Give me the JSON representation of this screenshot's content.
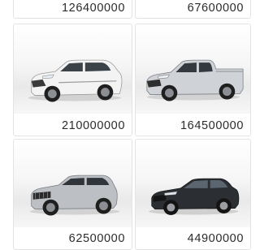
{
  "listings": [
    {
      "price": "126400000",
      "image": "car-image"
    },
    {
      "price": "67600000",
      "image": "car-image"
    },
    {
      "price": "210000000",
      "image": "white-suv-image",
      "color": "#f4f4f4"
    },
    {
      "price": "164500000",
      "image": "silver-pickup-truck-image",
      "color": "#c9cdd1"
    },
    {
      "price": "62500000",
      "image": "silver-compact-suv-image",
      "color": "#b9bdc1"
    },
    {
      "price": "44900000",
      "image": "black-sedan-image",
      "color": "#2a2d31"
    }
  ]
}
